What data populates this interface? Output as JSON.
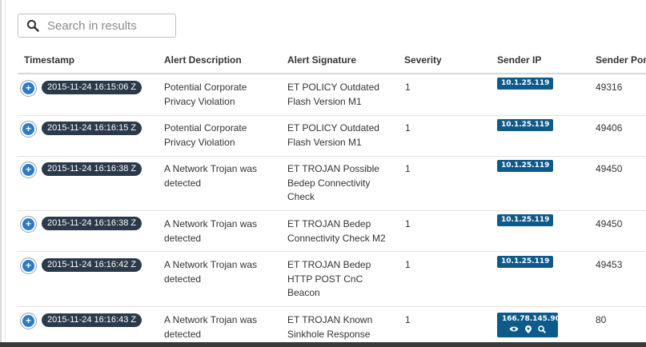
{
  "search": {
    "placeholder": "Search in results",
    "value": ""
  },
  "columns": [
    "Timestamp",
    "Alert Description",
    "Alert Signature",
    "Severity",
    "Sender IP",
    "Sender Port"
  ],
  "rows": [
    {
      "timestamp": "2015-11-24 16:15:06 Z",
      "desc1": "Potential Corporate",
      "desc2": "Privacy Violation",
      "sig1": "ET POLICY Outdated",
      "sig2": "Flash Version M1",
      "sig3": "",
      "severity": "1",
      "ip": "10.1.25.119",
      "port": "49316"
    },
    {
      "timestamp": "2015-11-24 16:16:15 Z",
      "desc1": "Potential Corporate",
      "desc2": "Privacy Violation",
      "sig1": "ET POLICY Outdated",
      "sig2": "Flash Version M1",
      "sig3": "",
      "severity": "1",
      "ip": "10.1.25.119",
      "port": "49406"
    },
    {
      "timestamp": "2015-11-24 16:16:38 Z",
      "desc1": "A Network Trojan was",
      "desc2": "detected",
      "sig1": "ET TROJAN Possible",
      "sig2": "Bedep Connectivity",
      "sig3": "Check",
      "severity": "1",
      "ip": "10.1.25.119",
      "port": "49450"
    },
    {
      "timestamp": "2015-11-24 16:16:38 Z",
      "desc1": "A Network Trojan was",
      "desc2": "detected",
      "sig1": "ET TROJAN Bedep",
      "sig2": "Connectivity Check M2",
      "sig3": "",
      "severity": "1",
      "ip": "10.1.25.119",
      "port": "49450"
    },
    {
      "timestamp": "2015-11-24 16:16:42 Z",
      "desc1": "A Network Trojan was",
      "desc2": "detected",
      "sig1": "ET TROJAN Bedep",
      "sig2": "HTTP POST CnC",
      "sig3": "Beacon",
      "severity": "1",
      "ip": "10.1.25.119",
      "port": "49453"
    },
    {
      "timestamp": "2015-11-24 16:16:43 Z",
      "desc1": "A Network Trojan was",
      "desc2": "detected",
      "sig1": "ET TROJAN Known",
      "sig2": "Sinkhole Response",
      "sig3": "",
      "severity": "1",
      "ip": "166.78.145.90",
      "port": "80"
    }
  ],
  "icons": {
    "search": "search-icon",
    "expand": "plus-icon",
    "ip_tools": [
      "eye-icon",
      "map-marker-icon",
      "search-icon"
    ]
  },
  "colors": {
    "badge": "#2b3a4a",
    "ip_badge": "#0e5a8a",
    "expand": "#2d7bc4"
  }
}
